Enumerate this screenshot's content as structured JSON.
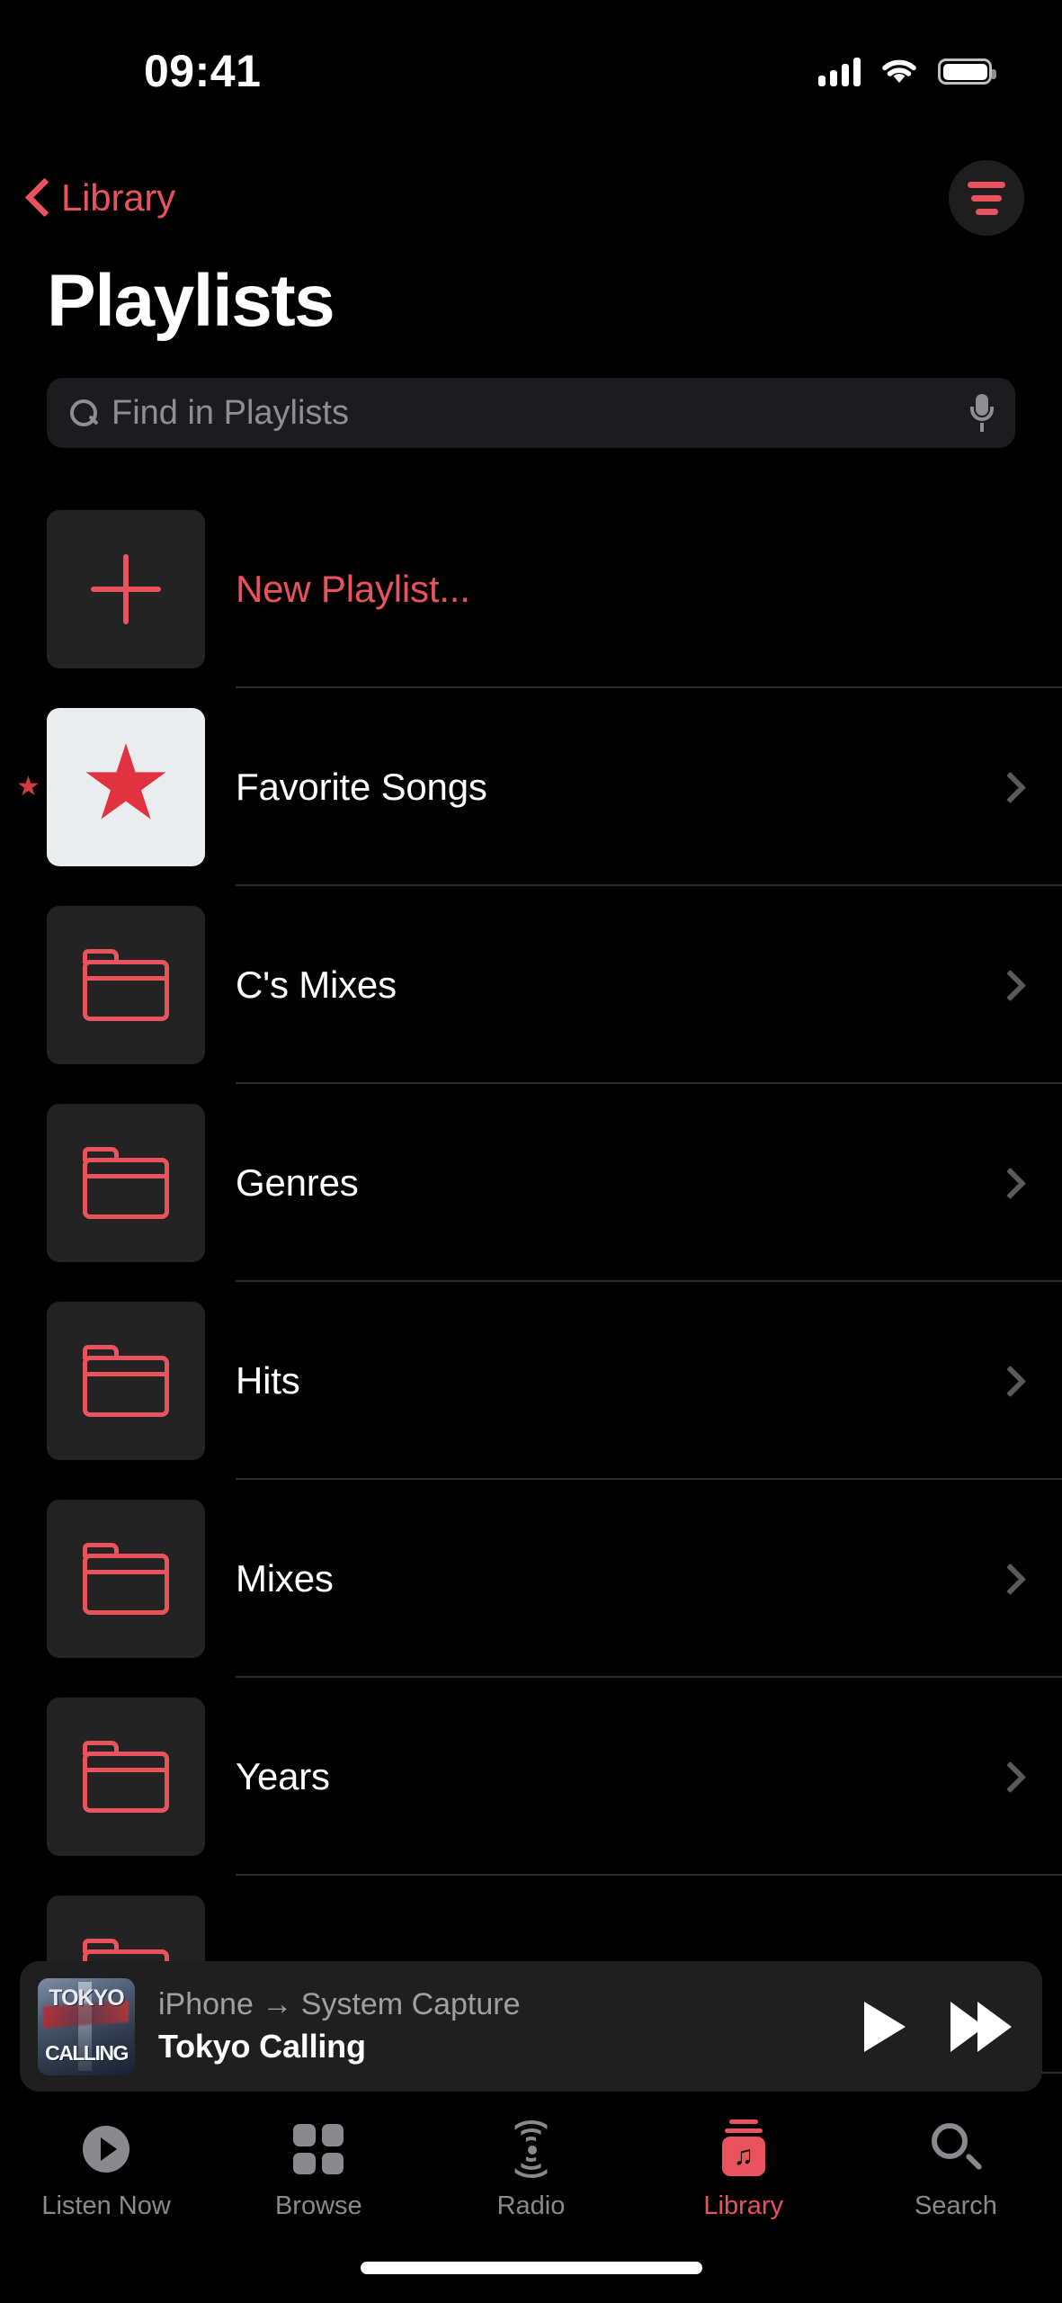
{
  "status_bar": {
    "time": "09:41",
    "signal_icon": "cellular-signal-icon",
    "wifi_icon": "wifi-icon",
    "battery_icon": "battery-icon"
  },
  "nav": {
    "back_label": "Library",
    "back_icon": "chevron-left-icon",
    "sort_icon": "sort-filter-icon"
  },
  "header": {
    "title": "Playlists"
  },
  "search": {
    "placeholder": "Find in Playlists",
    "search_icon": "search-icon",
    "mic_icon": "microphone-icon"
  },
  "colors": {
    "accent": "#E8535E",
    "background": "#000000",
    "tile": "#232323",
    "separator": "#2B2B2B",
    "secondary_text": "#8E8E93"
  },
  "list": {
    "rows": [
      {
        "label": "New Playlist...",
        "icon": "plus-icon",
        "style": "accent",
        "chevron": false,
        "favorite_mark": false
      },
      {
        "label": "Favorite Songs",
        "icon": "star-icon",
        "style": "default",
        "chevron": true,
        "favorite_mark": true,
        "tile": "white"
      },
      {
        "label": "C's Mixes",
        "icon": "folder-icon",
        "style": "default",
        "chevron": true,
        "favorite_mark": false
      },
      {
        "label": "Genres",
        "icon": "folder-icon",
        "style": "default",
        "chevron": true,
        "favorite_mark": false
      },
      {
        "label": "Hits",
        "icon": "folder-icon",
        "style": "default",
        "chevron": true,
        "favorite_mark": false
      },
      {
        "label": "Mixes",
        "icon": "folder-icon",
        "style": "default",
        "chevron": true,
        "favorite_mark": false
      },
      {
        "label": "Years",
        "icon": "folder-icon",
        "style": "default",
        "chevron": true,
        "favorite_mark": false
      },
      {
        "label": "",
        "icon": "folder-icon",
        "style": "default",
        "chevron": false,
        "favorite_mark": false
      }
    ]
  },
  "mini_player": {
    "route": "iPhone → System Capture",
    "title": "Tokyo Calling",
    "album_art_line1": "TOKYO",
    "album_art_line2": "CALLING",
    "play_icon": "play-icon",
    "forward_icon": "fast-forward-icon"
  },
  "tab_bar": {
    "tabs": [
      {
        "label": "Listen Now",
        "icon": "listen-now-icon",
        "active": false
      },
      {
        "label": "Browse",
        "icon": "browse-grid-icon",
        "active": false
      },
      {
        "label": "Radio",
        "icon": "radio-broadcast-icon",
        "active": false
      },
      {
        "label": "Library",
        "icon": "library-icon",
        "active": true
      },
      {
        "label": "Search",
        "icon": "search-magnifier-icon",
        "active": false
      }
    ]
  }
}
